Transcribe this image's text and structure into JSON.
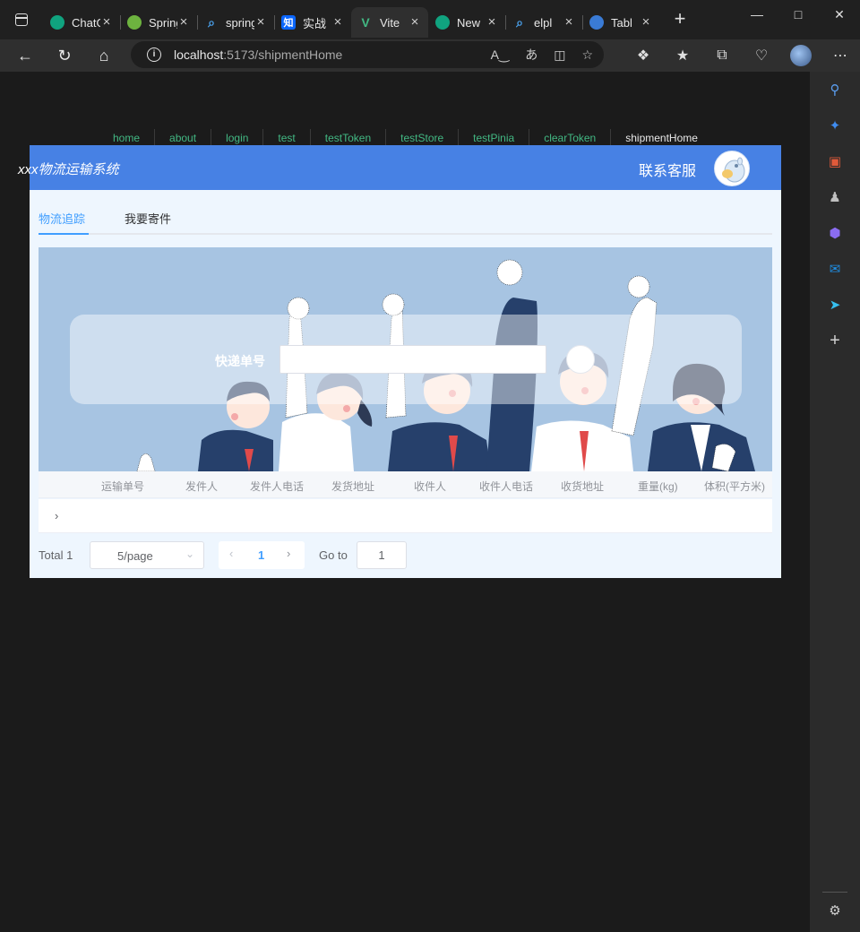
{
  "browser": {
    "tabs": [
      {
        "title": "ChatGPT",
        "icon": "chatgpt-icon",
        "color": "#10a37f"
      },
      {
        "title": "Spring",
        "icon": "spring-icon",
        "color": "#6db33f"
      },
      {
        "title": "spring",
        "icon": "search-icon",
        "color": "#4aa3f0"
      },
      {
        "title": "实战",
        "icon": "zhihu-icon",
        "color": "#0a66ff"
      },
      {
        "title": "Vite",
        "icon": "vue-icon",
        "color": "#42b883",
        "active": true
      },
      {
        "title": "New",
        "icon": "chatgpt-icon",
        "color": "#10a37f"
      },
      {
        "title": "elpl",
        "icon": "search-icon",
        "color": "#4aa3f0"
      },
      {
        "title": "Tabl",
        "icon": "table-icon",
        "color": "#3a7bd5"
      }
    ],
    "url_host": "localhost",
    "url_path": ":5173/shipmentHome"
  },
  "nav": {
    "links": [
      "home",
      "about",
      "login",
      "test",
      "testToken",
      "testStore",
      "testPinia",
      "clearToken",
      "shipmentHome"
    ]
  },
  "header": {
    "title": "xxx物流运输系统",
    "contact": "联系客服"
  },
  "tabs": {
    "track": "物流追踪",
    "send": "我要寄件"
  },
  "search": {
    "label": "快递单号",
    "placeholder": ""
  },
  "table": {
    "columns": [
      "运输单号",
      "发件人",
      "发件人电话",
      "发货地址",
      "收件人",
      "收件人电话",
      "收货地址",
      "重量(kg)",
      "体积(平方米)"
    ]
  },
  "pagination": {
    "total": "Total 1",
    "page_size": "5/page",
    "current_page": "1",
    "goto_label": "Go to",
    "goto_value": "1"
  },
  "colors": {
    "header": "#4781e4",
    "accent": "#409eff",
    "nav_link": "#42b883"
  }
}
